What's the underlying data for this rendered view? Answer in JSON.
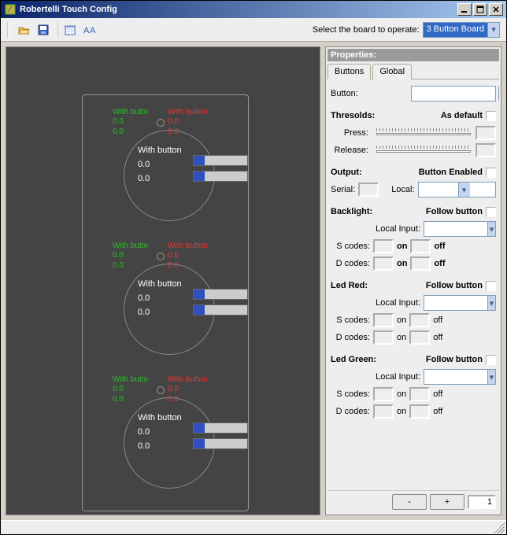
{
  "title": "Robertelli Touch Config",
  "toolbar": {
    "select_label": "Select the board to operate:",
    "selected_board": "3 Button Board"
  },
  "board": {
    "buttons": [
      {
        "green_label": "With butto",
        "green_v1": "0.0",
        "green_v2": "0.0",
        "red_label": "With button",
        "red_v1": "0.0",
        "red_v2": "0.0",
        "white_label": "With button",
        "white_v1": "0.0",
        "white_v2": "0.0"
      },
      {
        "green_label": "With butto",
        "green_v1": "0.0",
        "green_v2": "0.0",
        "red_label": "With button",
        "red_v1": "0.0",
        "red_v2": "0.0",
        "white_label": "With button",
        "white_v1": "0.0",
        "white_v2": "0.0"
      },
      {
        "green_label": "With butto",
        "green_v1": "0.0",
        "green_v2": "0.0",
        "red_label": "With button",
        "red_v1": "0.0",
        "red_v2": "0.0",
        "white_label": "With button",
        "white_v1": "0.0",
        "white_v2": "0.0"
      }
    ]
  },
  "properties": {
    "title": "Properties:",
    "tabs": {
      "buttons": "Buttons",
      "global": "Global"
    },
    "button_label": "Button:",
    "thresholds": {
      "title": "Thresolds:",
      "as_default": "As default",
      "press": "Press:",
      "release": "Release:"
    },
    "output": {
      "title": "Output:",
      "enabled": "Button Enabled",
      "serial": "Serial:",
      "local": "Local:"
    },
    "backlight": {
      "title": "Backlight:",
      "follow": "Follow button",
      "local_input": "Local Input:",
      "s_codes": "S codes:",
      "d_codes": "D codes:",
      "on": "on",
      "off": "off"
    },
    "led_red": {
      "title": "Led Red:",
      "follow": "Follow button",
      "local_input": "Local Input:",
      "s_codes": "S codes:",
      "d_codes": "D codes:",
      "on": "on",
      "off": "off"
    },
    "led_green": {
      "title": "Led Green:",
      "follow": "Follow button",
      "local_input": "Local Input:",
      "s_codes": "S codes:",
      "d_codes": "D codes:",
      "on": "on",
      "off": "off"
    },
    "footer": {
      "minus": "-",
      "plus": "+",
      "count": "1"
    }
  }
}
